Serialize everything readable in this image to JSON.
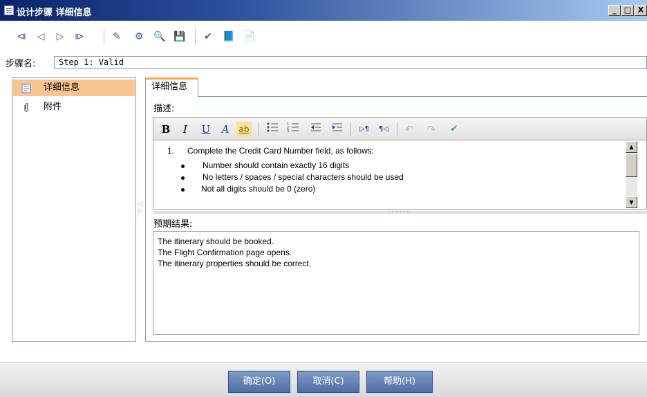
{
  "window": {
    "title": "设计步骤 详细信息",
    "minimize": "_",
    "maximize": "□",
    "close": "X"
  },
  "toolbar": {
    "buttons": [
      {
        "name": "first-record-icon",
        "glyph": "⧏"
      },
      {
        "name": "previous-record-icon",
        "glyph": "◁"
      },
      {
        "name": "next-record-icon",
        "glyph": "▷"
      },
      {
        "name": "last-record-icon",
        "glyph": "⧐"
      },
      {
        "name": "clear-icon",
        "glyph": "✎"
      },
      {
        "name": "parameter-icon",
        "glyph": "⚙"
      },
      {
        "name": "search-icon",
        "glyph": "🔍"
      },
      {
        "name": "save-icon",
        "glyph": "💾"
      },
      {
        "name": "spell-check-icon",
        "glyph": "✔"
      },
      {
        "name": "thesaurus-icon",
        "glyph": "📘"
      },
      {
        "name": "spelling-options-icon",
        "glyph": "📄"
      }
    ]
  },
  "step": {
    "label": "步骤名:",
    "value": "Step 1: Valid"
  },
  "nav": {
    "items": [
      {
        "label": "详细信息"
      },
      {
        "label": "附件"
      }
    ]
  },
  "tabs": [
    {
      "label": "详细信息"
    }
  ],
  "description": {
    "label": "描述:",
    "toolbar": {
      "bold": "B",
      "italic": "I",
      "underline": "U",
      "font_color": "A",
      "highlight": "ab"
    },
    "items": [
      {
        "marker": "1.",
        "text": "Complete the Credit Card Number field, as follows:"
      },
      {
        "marker": "•",
        "text": "Number should contain exactly 16 digits"
      },
      {
        "marker": "•",
        "text": "No letters / spaces / special characters should be used"
      },
      {
        "marker": "•",
        "text": "Not all digits should be 0 (zero)"
      }
    ]
  },
  "expected": {
    "label": "预期结果:",
    "lines": [
      "The itinerary should be booked.",
      "The Flight Confirmation page opens.",
      "The itinerary properties should be correct."
    ]
  },
  "buttons": {
    "ok": "确定(O)",
    "cancel": "取消(C)",
    "help": "帮助(H)"
  },
  "colors": {
    "selected_nav": "#f9c490",
    "tab_accent": "#f9a64d",
    "dialog_button": "#5d7cb2"
  }
}
